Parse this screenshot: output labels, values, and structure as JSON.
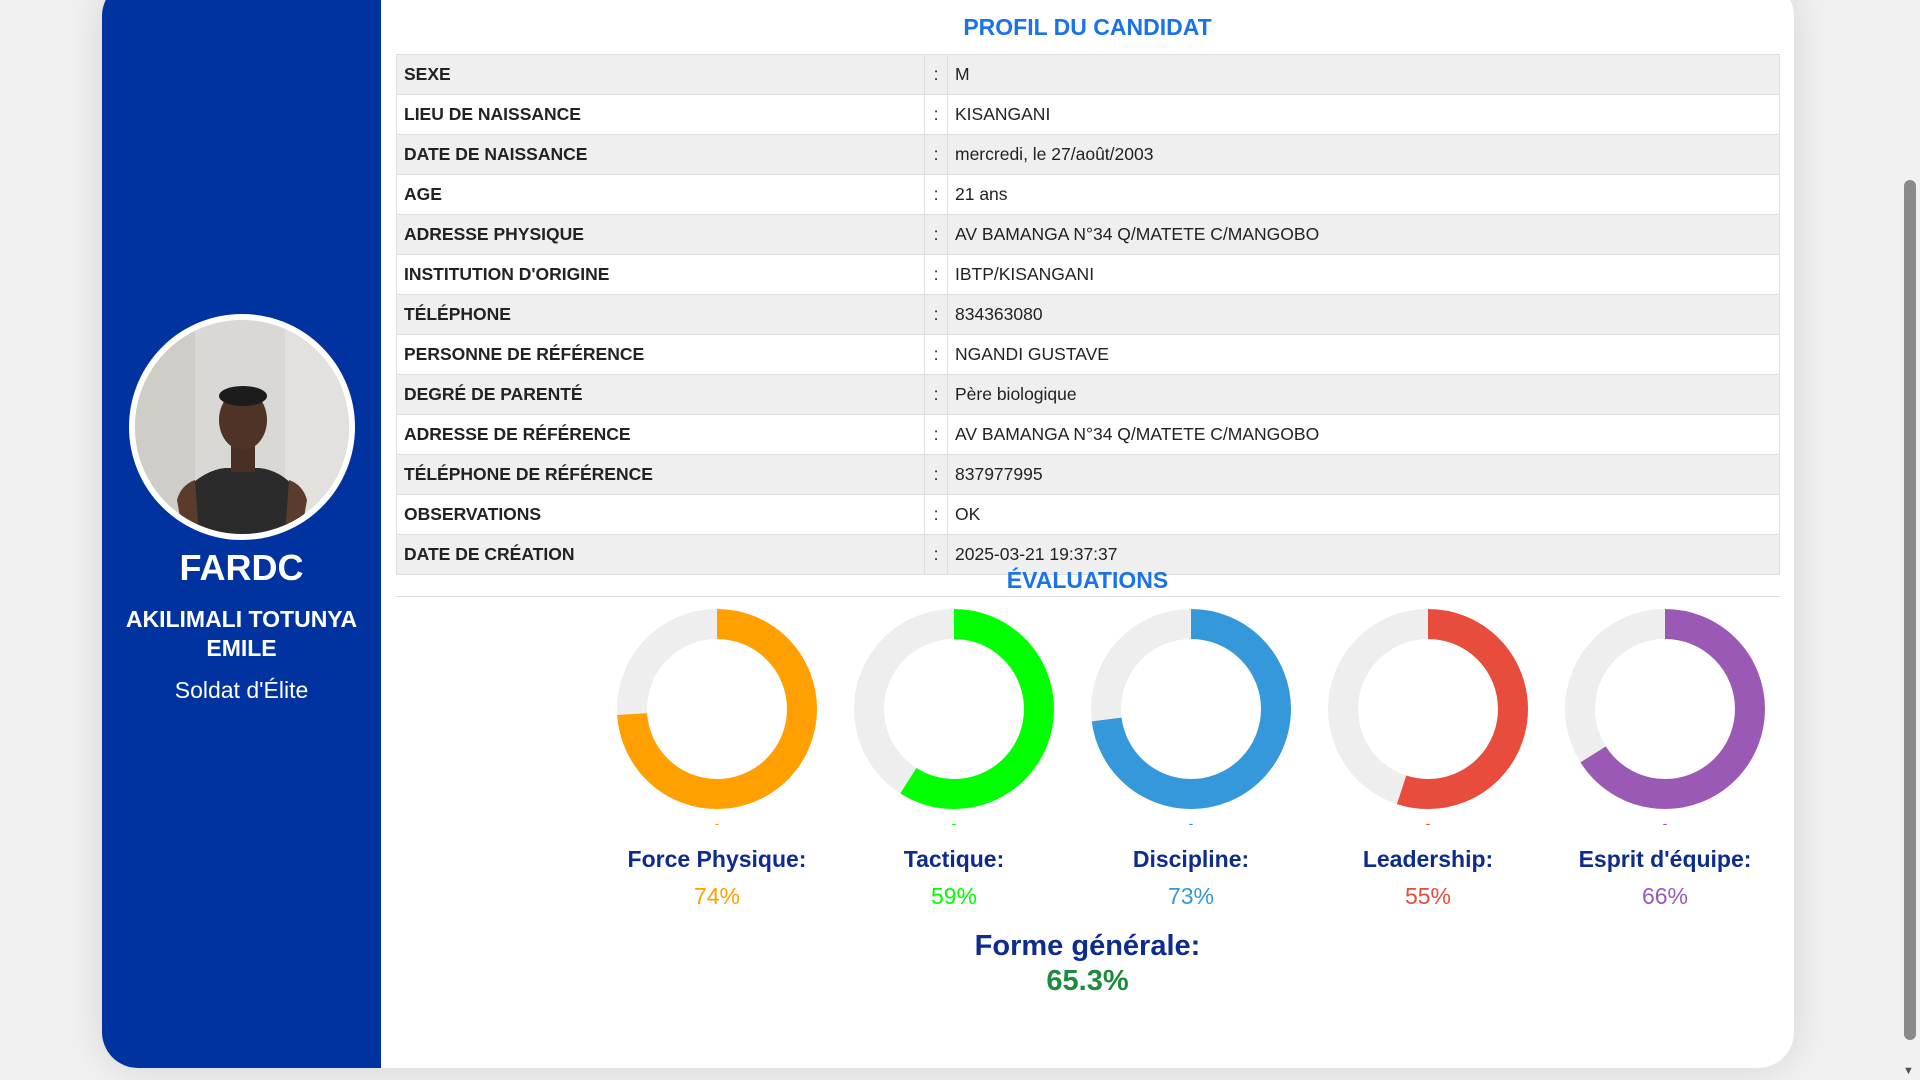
{
  "sidebar": {
    "brand": "FARDC",
    "name": "AKILIMALI TOTUNYA EMILE",
    "rank": "Soldat d'Élite"
  },
  "profile": {
    "title": "PROFIL DU CANDIDAT",
    "separator": ":",
    "rows": [
      {
        "label": "SEXE",
        "value": "M"
      },
      {
        "label": "LIEU DE NAISSANCE",
        "value": "KISANGANI"
      },
      {
        "label": "DATE DE NAISSANCE",
        "value": "mercredi, le 27/août/2003"
      },
      {
        "label": "AGE",
        "value": "21 ans"
      },
      {
        "label": "ADRESSE PHYSIQUE",
        "value": "AV BAMANGA N°34 Q/MATETE C/MANGOBO"
      },
      {
        "label": "INSTITUTION D'ORIGINE",
        "value": "IBTP/KISANGANI"
      },
      {
        "label": "TÉLÉPHONE",
        "value": "834363080"
      },
      {
        "label": "PERSONNE DE RÉFÉRENCE",
        "value": "NGANDI GUSTAVE"
      },
      {
        "label": "DEGRÉ DE PARENTÉ",
        "value": "Père biologique"
      },
      {
        "label": "ADRESSE DE RÉFÉRENCE",
        "value": "AV BAMANGA N°34 Q/MATETE C/MANGOBO"
      },
      {
        "label": "TÉLÉPHONE DE RÉFÉRENCE",
        "value": "837977995"
      },
      {
        "label": "OBSERVATIONS",
        "value": "OK"
      },
      {
        "label": "DATE DE CRÉATION",
        "value": "2025-03-21 19:37:37"
      }
    ]
  },
  "evaluations": {
    "title": "ÉVALUATIONS",
    "items": [
      {
        "label": "Force Physique:",
        "value_text": "74%",
        "percent": 74,
        "color": "#ffa000",
        "dash": "-"
      },
      {
        "label": "Tactique:",
        "value_text": "59%",
        "percent": 59,
        "color": "#00ff00",
        "dash": "-"
      },
      {
        "label": "Discipline:",
        "value_text": "73%",
        "percent": 73,
        "color": "#3498db",
        "dash": "-"
      },
      {
        "label": "Leadership:",
        "value_text": "55%",
        "percent": 55,
        "color": "#e74c3c",
        "dash": "-"
      },
      {
        "label": "Esprit d'équipe:",
        "value_text": "66%",
        "percent": 66,
        "color": "#9b59b6",
        "dash": "-"
      }
    ],
    "overall_label": "Forme générale:",
    "overall_value": "65.3%"
  },
  "colors": {
    "sidebar_bg": "#0033a0",
    "section_title": "#1a73e8",
    "metric_label": "#0d2c8c",
    "overall_value": "#1e8a3e",
    "ring_track": "#eeeeee"
  }
}
